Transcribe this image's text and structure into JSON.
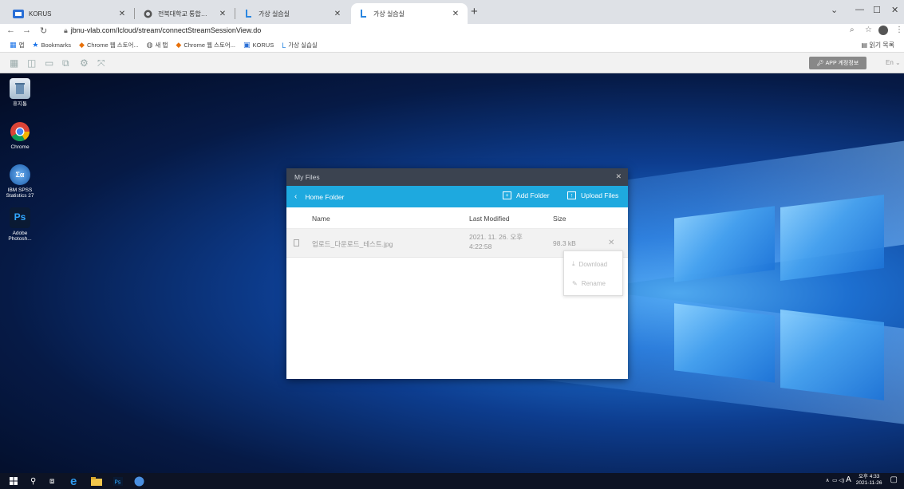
{
  "browser": {
    "tabs": [
      {
        "title": "KORUS",
        "icon": "korus-icon"
      },
      {
        "title": "전북대학교 통합정보시스템(OASIS)",
        "icon": "globe-icon"
      },
      {
        "title": "가상 실습실",
        "icon": "vlab-icon"
      },
      {
        "title": "가상 실습실",
        "icon": "vlab-icon",
        "active": true
      }
    ],
    "url": "jbnu-vlab.com/lcloud/stream/connectStreamSessionView.do",
    "bookmarks": [
      {
        "label": "앱",
        "icon": "apps-grid-icon"
      },
      {
        "label": "Bookmarks",
        "icon": "star-icon"
      },
      {
        "label": "Chrome 웹 스토어...",
        "icon": "chrome-store-icon"
      },
      {
        "label": "새 탭",
        "icon": "globe-icon"
      },
      {
        "label": "Chrome 웹 스토어...",
        "icon": "chrome-store-icon"
      },
      {
        "label": "KORUS",
        "icon": "korus-icon"
      },
      {
        "label": "가상 실습실",
        "icon": "vlab-icon"
      }
    ],
    "reading_list": "읽기 목록"
  },
  "session_toolbar": {
    "app_info_button": "APP 계정정보",
    "language": "En"
  },
  "desktop": {
    "icons": [
      {
        "label": "휴지통",
        "icon": "recycle-bin-icon"
      },
      {
        "label": "Chrome",
        "icon": "chrome-icon"
      },
      {
        "label": "IBM SPSS Statistics 27",
        "icon": "spss-icon"
      },
      {
        "label": "Adobe Photosh...",
        "icon": "photoshop-icon"
      }
    ]
  },
  "dialog": {
    "title": "My Files",
    "folder": "Home Folder",
    "add_folder": "Add Folder",
    "upload_files": "Upload Files",
    "columns": {
      "name": "Name",
      "modified": "Last Modified",
      "size": "Size"
    },
    "files": [
      {
        "name": "업로드_다운로드_테스트.jpg",
        "modified_line1": "2021. 11. 26. 오후",
        "modified_line2": "4:22:58",
        "size": "98.3 kB"
      }
    ],
    "context_menu": {
      "download": "Download",
      "rename": "Rename"
    }
  },
  "taskbar": {
    "time": "오후 4:33",
    "date": "2021-11-26",
    "ime": "A"
  }
}
